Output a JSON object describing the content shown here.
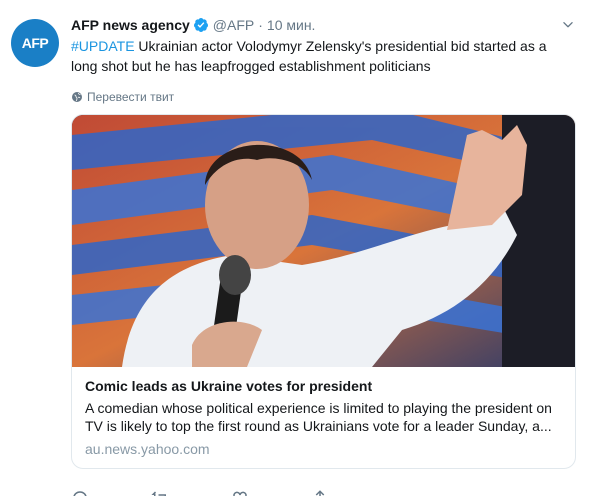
{
  "account": {
    "avatar_text": "AFP",
    "name": "AFP news agency",
    "handle": "@AFP",
    "separator": "·",
    "time": "10 мин."
  },
  "tweet": {
    "hashtag": "#UPDATE",
    "text": " Ukrainian actor Volodymyr Zelensky's presidential bid started as a long shot but he has leapfrogged establishment  politicians",
    "translate_label": "Перевести твит"
  },
  "card": {
    "title": "Comic leads as Ukraine votes for president",
    "description": "A comedian whose political experience is limited to playing the president on TV is likely to top the first round as Ukrainians vote for a leader Sunday, a...",
    "domain": "au.news.yahoo.com"
  },
  "icons": {
    "verified": "verified-badge-icon",
    "caret": "chevron-down-icon",
    "globe": "globe-icon",
    "reply": "reply-icon",
    "retweet": "retweet-icon",
    "like": "heart-icon",
    "share": "share-icon"
  },
  "colors": {
    "link": "#1b95e0",
    "secondary": "#657786",
    "avatar_bg": "#1a7fc6",
    "border": "#e1e8ed"
  }
}
